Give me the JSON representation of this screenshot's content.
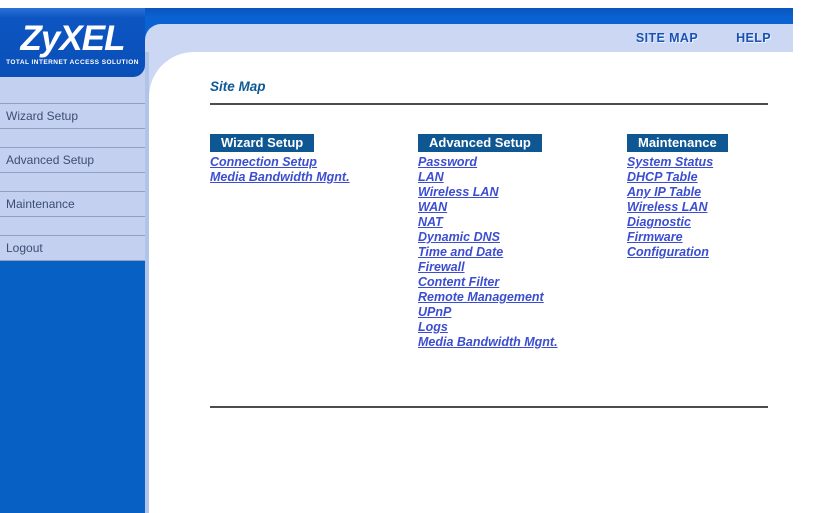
{
  "logo": {
    "brand": "ZyXEL",
    "tagline": "Total Internet Access Solution"
  },
  "top_nav": {
    "site_map": "SITE MAP",
    "help": "HELP"
  },
  "sidebar": {
    "items": [
      {
        "label": "Wizard Setup"
      },
      {
        "label": "Advanced Setup"
      },
      {
        "label": "Maintenance"
      },
      {
        "label": "Logout"
      }
    ]
  },
  "page": {
    "title": "Site Map"
  },
  "columns": [
    {
      "header": "Wizard Setup",
      "links": [
        "Connection Setup",
        "Media Bandwidth Mgnt."
      ]
    },
    {
      "header": "Advanced Setup",
      "links": [
        "Password",
        "LAN",
        "Wireless LAN",
        "WAN",
        "NAT",
        "Dynamic DNS",
        "Time and Date",
        "Firewall",
        "Content Filter",
        "Remote Management",
        "UPnP",
        "Logs",
        "Media Bandwidth Mgnt."
      ]
    },
    {
      "header": "Maintenance",
      "links": [
        "System Status",
        "DHCP Table",
        "Any IP Table",
        "Wireless LAN",
        "Diagnostic",
        "Firmware",
        "Configuration"
      ]
    }
  ],
  "colors": {
    "top_bar_blue": "#0b62d2",
    "logo_blue": "#0d55c2",
    "nav_bar_lavender": "#cbd7f3",
    "sidebar_lavender": "#c3d0ef",
    "sidebar_bottom_blue": "#0760c4",
    "column_header_bg": "#0e5792",
    "link_blue": "#3c4ed0",
    "title_blue": "#0d5a97",
    "sidebar_text": "#3d4d74"
  }
}
